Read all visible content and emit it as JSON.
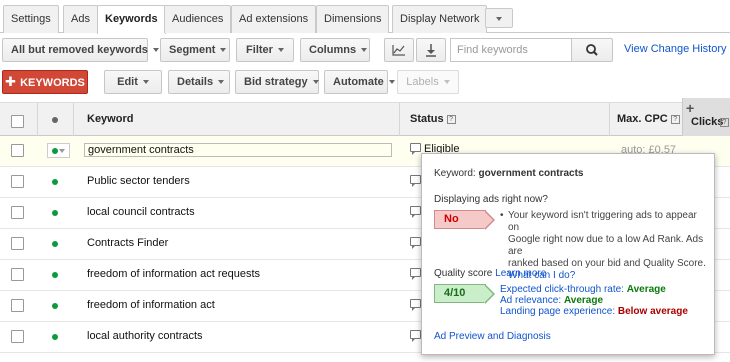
{
  "tabs": [
    "Settings",
    "Ads",
    "Keywords",
    "Audiences",
    "Ad extensions",
    "Dimensions",
    "Display Network"
  ],
  "toolbar": {
    "filter_view": "All but removed keywords",
    "segment": "Segment",
    "filter": "Filter",
    "columns": "Columns",
    "search_placeholder": "Find keywords",
    "view_change_history": "View Change History"
  },
  "actions": {
    "add_keywords": "KEYWORDS",
    "edit": "Edit",
    "details": "Details",
    "bid_strategy": "Bid strategy",
    "automate": "Automate",
    "labels": "Labels"
  },
  "table": {
    "headers": {
      "keyword": "Keyword",
      "status": "Status",
      "max_cpc": "Max. CPC",
      "clicks": "Clicks"
    },
    "help_glyph": "?",
    "rows": [
      {
        "keyword": "government contracts",
        "status": "Eligible",
        "max_cpc": "auto: £0.57"
      },
      {
        "keyword": "Public sector tenders"
      },
      {
        "keyword": "local council contracts"
      },
      {
        "keyword": "Contracts Finder"
      },
      {
        "keyword": "freedom of information act requests"
      },
      {
        "keyword": "freedom of information act"
      },
      {
        "keyword": "local authority contracts"
      }
    ]
  },
  "popup": {
    "keyword_label": "Keyword:",
    "keyword_value": "government contracts",
    "displaying_question": "Displaying ads right now?",
    "displaying_answer": "No",
    "bullet": "•",
    "explanation_lines": [
      "Your keyword isn't triggering ads to appear on",
      "Google right now due to a low Ad Rank. Ads are",
      "ranked based on your bid and Quality Score."
    ],
    "what_can_i_do": "What can I do?",
    "quality_score_label": "Quality score",
    "learn_more": "Learn more",
    "quality_score_value": "4/10",
    "ctr_label": "Expected click-through rate:",
    "ctr_value": "Average",
    "relevance_label": "Ad relevance:",
    "relevance_value": "Average",
    "landing_label": "Landing page experience:",
    "landing_value": "Below average",
    "diagnosis_link": "Ad Preview and Diagnosis"
  },
  "colors": {
    "accent_red": "#d14836",
    "link_blue": "#1155cc",
    "status_green": "#0a9b3c"
  }
}
